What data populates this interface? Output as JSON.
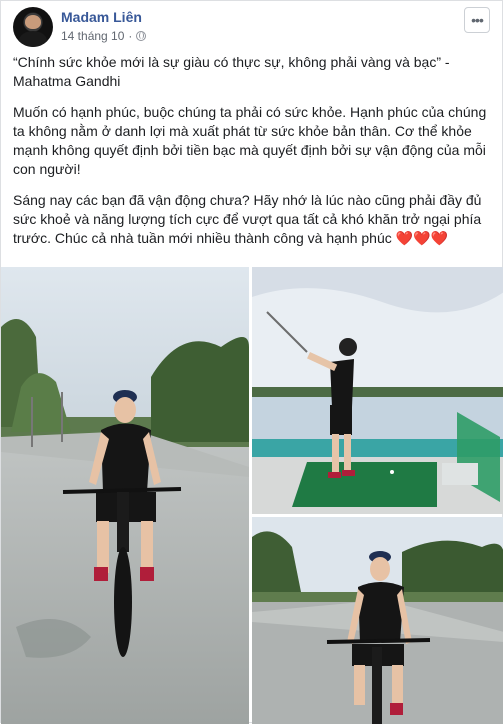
{
  "post": {
    "author": "Madam Liên",
    "date": "14 tháng 10",
    "separator": "·",
    "more_icon": "more-options-icon",
    "quote": "“Chính sức khỏe mới là sự giàu có thực sự, không phải vàng và bạc” - Mahatma Gandhi",
    "paragraph2": "Muốn có hạnh phúc, buộc chúng ta phải có sức khỏe. Hạnh phúc của chúng ta không nằm ở danh lợi mà xuất phát từ sức khỏe bản thân. Cơ thể khỏe mạnh không quyết định bởi tiền bạc mà quyết định bởi sự vận động của mỗi con người!",
    "paragraph3": "Sáng nay các bạn đã vận động chưa? Hãy nhớ là lúc nào cũng phải đầy đủ sức khoẻ và năng lượng tích cực để vượt qua tất cả khó khăn trở ngại phía trước. Chúc cả nhà tuần mới nhiều thành công và hạnh phúc",
    "hearts": "❤️❤️❤️"
  },
  "colors": {
    "author": "#385898",
    "meta": "#616770",
    "heart": "#e0245e"
  }
}
